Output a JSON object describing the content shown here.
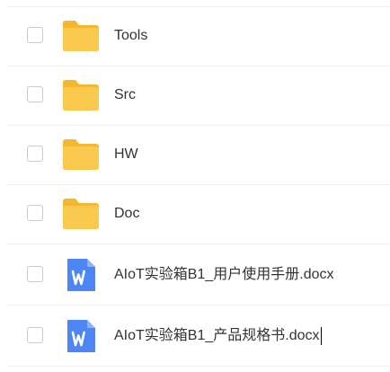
{
  "files": [
    {
      "name": "Tools",
      "type": "folder",
      "icon": "folder-icon"
    },
    {
      "name": "Src",
      "type": "folder",
      "icon": "folder-icon"
    },
    {
      "name": "HW",
      "type": "folder",
      "icon": "folder-icon"
    },
    {
      "name": "Doc",
      "type": "folder",
      "icon": "folder-icon"
    },
    {
      "name": "AIoT实验箱B1_用户使用手册.docx",
      "type": "docx",
      "icon": "word-document-icon"
    },
    {
      "name": "AIoT实验箱B1_产品规格书.docx",
      "type": "docx",
      "icon": "word-document-icon"
    }
  ],
  "colors": {
    "folder": "#f9c94d",
    "folder_tab": "#f5b72f",
    "word": "#4c86f5",
    "checkbox_border": "#c5cad3",
    "divider": "#eeeff1"
  }
}
